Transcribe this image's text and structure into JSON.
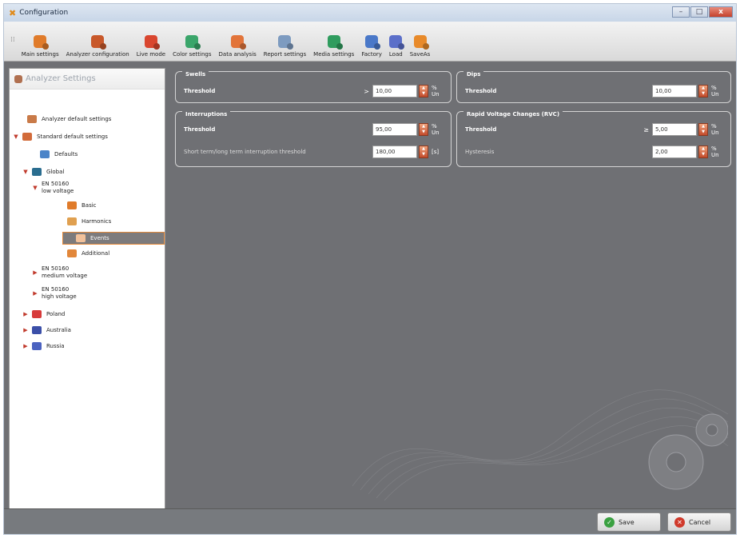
{
  "window": {
    "title": "Configuration",
    "minimize": "–",
    "maximize": "□",
    "close": "x"
  },
  "toolbar": [
    {
      "label": "Main settings",
      "icon": "main-settings-icon",
      "color": "#e07b2a"
    },
    {
      "label": "Analyzer configuration",
      "icon": "analyzer-config-icon",
      "color": "#c8582a"
    },
    {
      "label": "Live mode",
      "icon": "live-mode-icon",
      "color": "#d9462f"
    },
    {
      "label": "Color settings",
      "icon": "color-settings-icon",
      "color": "#3aa56a"
    },
    {
      "label": "Data analysis",
      "icon": "data-analysis-icon",
      "color": "#e2743a"
    },
    {
      "label": "Report settings",
      "icon": "report-settings-icon",
      "color": "#7d9bc0"
    },
    {
      "label": "Media settings",
      "icon": "media-settings-icon",
      "color": "#2f9c5e"
    },
    {
      "label": "Factory",
      "icon": "factory-icon",
      "color": "#4a78c8"
    },
    {
      "label": "Load",
      "icon": "load-icon",
      "color": "#5b6fc9"
    },
    {
      "label": "SaveAs",
      "icon": "save-as-icon",
      "color": "#e88a2a"
    }
  ],
  "sidebar": {
    "header": "Analyzer Settings",
    "items": [
      {
        "label": "Analyzer default settings",
        "arrow": "",
        "color": "#c97a48"
      },
      {
        "label": "Standard default settings",
        "arrow": "▼",
        "color": "#d26b3a"
      },
      {
        "label": "Defaults",
        "arrow": "",
        "color": "#4b84c8"
      },
      {
        "label": "Global",
        "arrow": "▼",
        "color": "#2a6d8f"
      },
      {
        "label": "EN 50160\nlow voltage",
        "arrow": "▼",
        "color": ""
      },
      {
        "label": "Basic",
        "arrow": "",
        "color": "#e07b2a"
      },
      {
        "label": "Harmonics",
        "arrow": "",
        "color": "#e0a050"
      },
      {
        "label": "Events",
        "arrow": "",
        "color": "#f2c19a"
      },
      {
        "label": "Additional",
        "arrow": "",
        "color": "#e2873a"
      },
      {
        "label": "EN 50160\nmedium voltage",
        "arrow": "▶",
        "color": ""
      },
      {
        "label": "EN 50160\nhigh voltage",
        "arrow": "▶",
        "color": ""
      },
      {
        "label": "Poland",
        "arrow": "▶",
        "color": "#d73a3a"
      },
      {
        "label": "Australia",
        "arrow": "▶",
        "color": "#3b4fa8"
      },
      {
        "label": "Russia",
        "arrow": "▶",
        "color": "#4b62c0"
      }
    ]
  },
  "swells": {
    "title": "Swells",
    "threshold_label": "Threshold",
    "comparator": ">",
    "value": "10,00",
    "unit": "% Un"
  },
  "dips": {
    "title": "Dips",
    "threshold_label": "Threshold",
    "value": "10,00",
    "unit": "% Un"
  },
  "interruptions": {
    "title": "Interruptions",
    "threshold_label": "Threshold",
    "threshold_value": "95,00",
    "threshold_unit": "% Un",
    "short_label": "Short term/long term interruption threshold",
    "short_value": "180,00",
    "short_unit": "[s]"
  },
  "rvc": {
    "title": "Rapid Voltage Changes (RVC)",
    "threshold_label": "Threshold",
    "comparator": "≥",
    "threshold_value": "5,00",
    "threshold_unit": "% Un",
    "hysteresis_label": "Hysteresis",
    "hysteresis_value": "2,00",
    "hysteresis_unit": "% Un"
  },
  "footer": {
    "save": "Save",
    "cancel": "Cancel"
  },
  "colors": {
    "accent": "#e48a3c",
    "panel_bg": "#6f7074",
    "save_icon": "#3aa141",
    "cancel_icon": "#d0392b"
  }
}
